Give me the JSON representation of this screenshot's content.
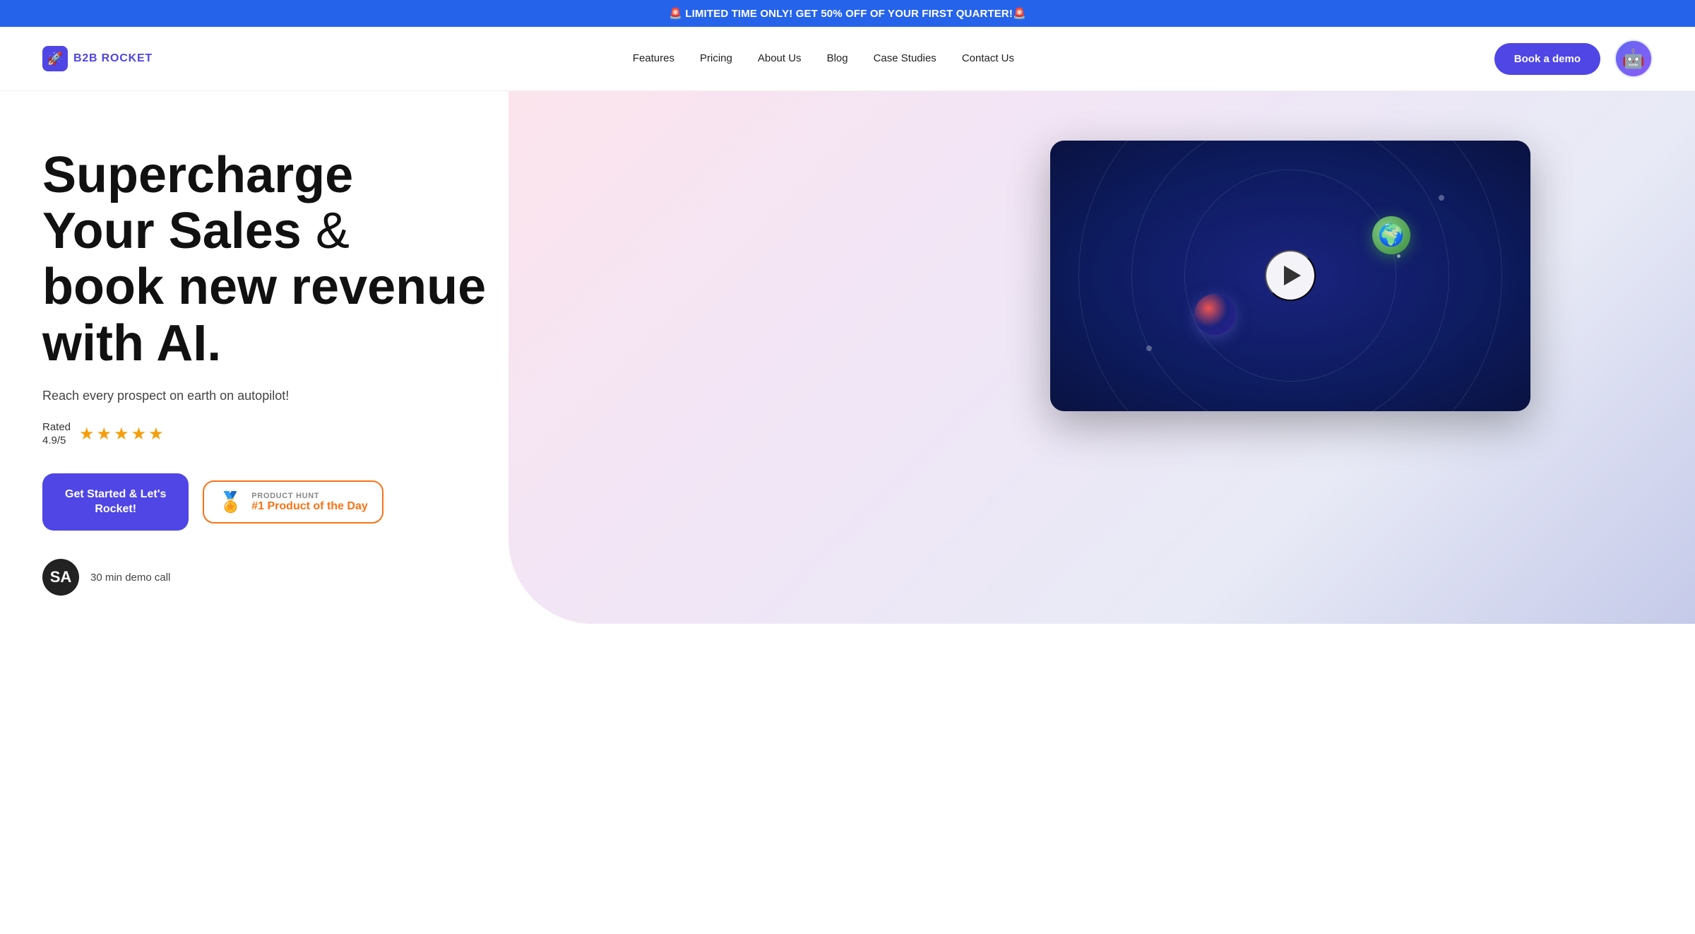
{
  "banner": {
    "text": "🚨 LIMITED TIME ONLY! GET 50% OFF OF YOUR FIRST QUARTER!🚨"
  },
  "nav": {
    "logo_text": "B2B ROCKET",
    "links": [
      {
        "label": "Features",
        "href": "#"
      },
      {
        "label": "Pricing",
        "href": "#"
      },
      {
        "label": "About Us",
        "href": "#"
      },
      {
        "label": "Blog",
        "href": "#"
      },
      {
        "label": "Case Studies",
        "href": "#"
      },
      {
        "label": "Contact Us",
        "href": "#"
      }
    ],
    "cta_label": "Book a demo"
  },
  "hero": {
    "title_line1": "Supercharge",
    "title_line2": "Your Sales",
    "title_ampersand": " &",
    "title_line3": "book new revenue",
    "title_line4": "with AI.",
    "subtitle": "Reach every prospect on earth on autopilot!",
    "rating_label": "Rated\n4.9/5",
    "get_started_label": "Get Started & Let's\nRocket!",
    "product_hunt_label_top": "PRODUCT HUNT",
    "product_hunt_label_bottom": "#1 Product of the Day",
    "demo_call_text": "30 min demo call"
  }
}
